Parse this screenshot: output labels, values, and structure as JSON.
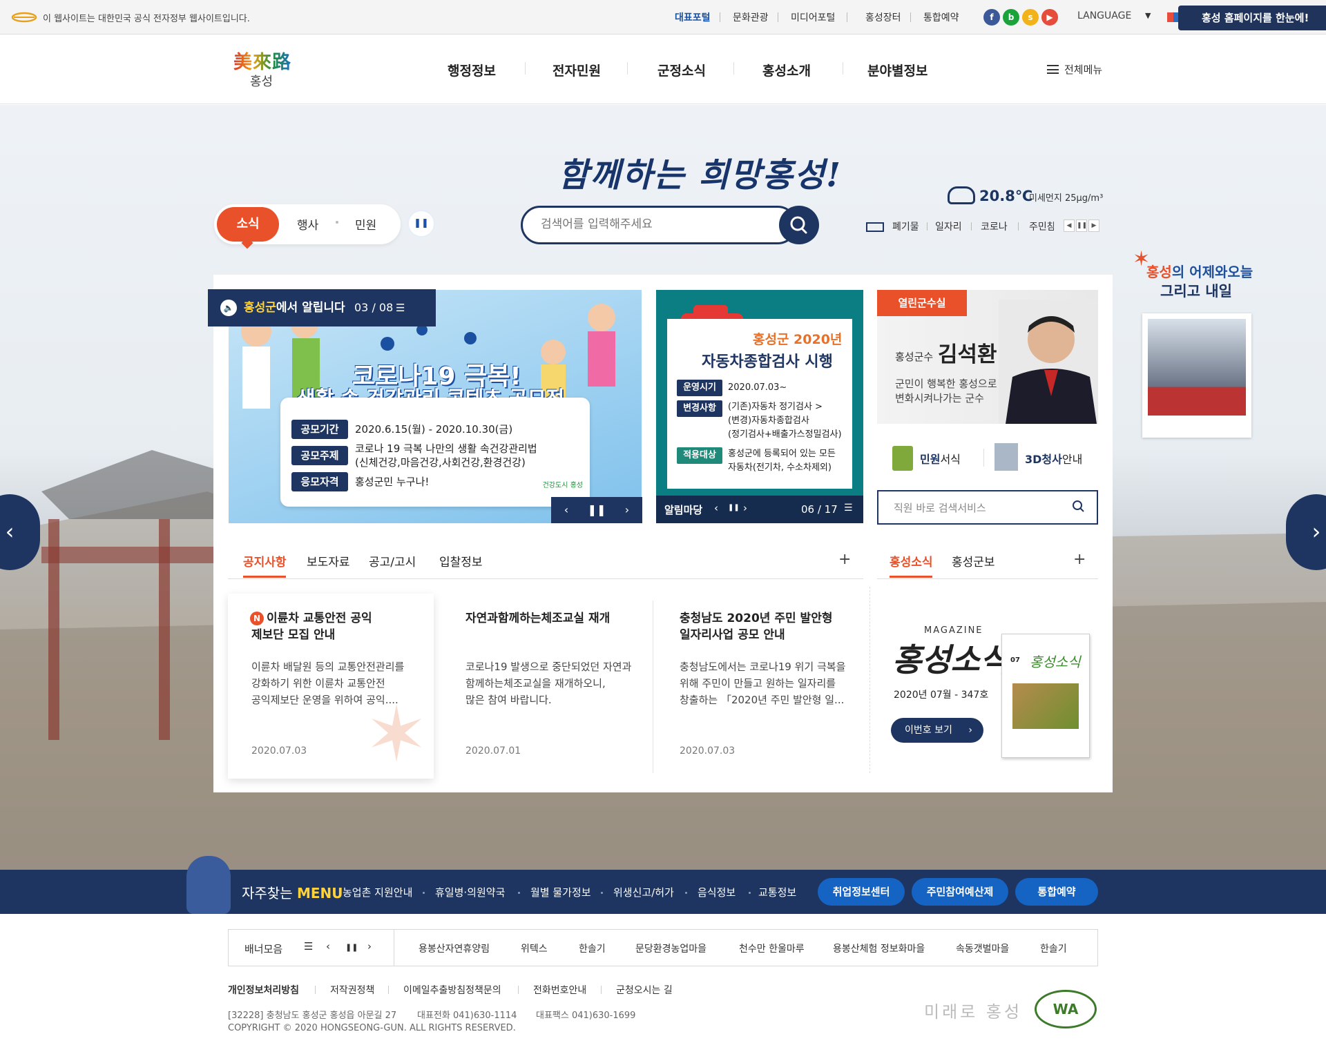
{
  "util": {
    "gov_notice": "이 웹사이트는 대한민국 공식 전자정부 웹사이트입니다.",
    "links": [
      "대표포털",
      "문화관광",
      "미디어포털",
      "홍성장터",
      "통합예약"
    ],
    "language": "LANGUAGE",
    "promo": "홍성 홈페이지를 한눈에!"
  },
  "header": {
    "logo_hanja": "美來路",
    "logo_sub": "홍성",
    "gnb": [
      "행정정보",
      "전자민원",
      "군정소식",
      "홍성소개",
      "분야별정보"
    ],
    "allmenu": "전체메뉴"
  },
  "visual": {
    "slogan": "함께하는 희망홍성!",
    "tabs": [
      "소식",
      "행사",
      "민원"
    ],
    "search_placeholder": "검색어를 입력해주세요",
    "weather": {
      "temp": "20.8℃",
      "dust": "미세먼지 25μg/m³"
    },
    "keywords": [
      "폐기물",
      "일자리",
      "코로나",
      "주민참"
    ]
  },
  "notice_banner": {
    "label_pre": "홍성군",
    "label_post": "에서 알립니다",
    "count": "03 / 08",
    "title1": "코로나19 극복!",
    "title2": "생활 속 건강관리 콘텐츠 공모전",
    "rows": [
      {
        "badge": "공모기간",
        "text": "2020.6.15(월) - 2020.10.30(금)"
      },
      {
        "badge": "공모주제",
        "text": "코로나 19 극복 나만의 생활 속건강관리법",
        "text2": "(신체건강,마음건강,사회건강,환경건강)"
      },
      {
        "badge": "응모자격",
        "text": "홍성군민 누구나!"
      }
    ],
    "brand": "건강도시 홍성"
  },
  "car_banner": {
    "title1": "홍성군 2020년",
    "title2": "자동차종합검사 시행",
    "rows": [
      {
        "badge": "운영시기",
        "text": "2020.07.03~"
      },
      {
        "badge": "변경사항",
        "text": "(기존)자동차 정기검사 >",
        "text2": "(변경)자동차종합검사",
        "text3": "(정기검사+배출가스정밀검사)"
      },
      {
        "badge": "적용대상",
        "text": "홍성군에 등록되어 있는 모든",
        "text2": "자동차(전기차, 수소차제외)"
      }
    ],
    "bar_label": "알림마당",
    "bar_count": "06 / 17"
  },
  "governor": {
    "tag": "열린군수실",
    "name_sub": "홍성군수",
    "name": "김석환",
    "desc1": "군민이 행복한 홍성으로",
    "desc2": "변화시켜나가는 군수"
  },
  "quick": {
    "civil_form_bold": "민원",
    "civil_form_rest": "서식",
    "hall_bold": "3D청사",
    "hall_rest": "안내",
    "staff_search": "직원 바로 검색서비스"
  },
  "board": {
    "tabs": [
      "공지사항",
      "보도자료",
      "공고/고시",
      "입찰정보"
    ],
    "plus": "+",
    "n_badge": "N",
    "items": [
      {
        "title1": "이륜차 교통안전 공익",
        "title2": "제보단 모집 안내",
        "body": [
          "이륜차 배달원 등의 교통안전관리를",
          "강화하기 위한 이륜차 교통안전",
          "공익제보단 운영을 위하여 공익...."
        ],
        "date": "2020.07.03"
      },
      {
        "title1": "자연과함께하는체조교실 재개",
        "title2": "",
        "body": [
          "코로나19 발생으로 중단되었던 자연과",
          "함께하는체조교실을 재개하오니,",
          "많은 참여 바랍니다."
        ],
        "date": "2020.07.01"
      },
      {
        "title1": "충청남도 2020년 주민 발안형",
        "title2": "일자리사업 공모 안내",
        "body": [
          "충청남도에서는 코로나19 위기 극복을",
          "위해 주민이 만들고 원하는 일자리를",
          "창출하는 「2020년 주민 발안형 일..."
        ],
        "date": "2020.07.03"
      }
    ]
  },
  "magazine": {
    "tabs": [
      "홍성소식",
      "홍성군보"
    ],
    "plus": "+",
    "label": "MAGAZINE",
    "title": "홍성소식",
    "issue": "2020년 07월 - 347호",
    "button": "이번호 보기",
    "cover_issue": "07"
  },
  "promo_side": {
    "line1_a": "홍성",
    "line1_b": "의 어제와오늘",
    "line2": "그리고 내일"
  },
  "freq": {
    "title_a": "자주찾는",
    "title_b": "MENU",
    "links": [
      "농업촌 지원안내",
      "휴일병·의원약국",
      "월별 물가정보",
      "위생신고/허가",
      "음식정보",
      "교통정보"
    ],
    "buttons": [
      "취업정보센터",
      "주민참여예산제",
      "통합예약"
    ]
  },
  "banners": {
    "label": "배너모음",
    "items": [
      "용봉산자연휴양림",
      "위텍스",
      "한솔기",
      "문당환경농업마을",
      "천수만 한울마루",
      "용봉산체험 정보화마을",
      "속동갯벌마을",
      "한솔기"
    ]
  },
  "footer": {
    "links": [
      "개인정보처리방침",
      "저작권정책",
      "이메일추출방침정책문의",
      "전화번호안내",
      "군청오시는 길"
    ],
    "address": "[32228] 충청남도 홍성군 홍성읍 아문길 27",
    "tel": "대표전화  041)630-1114",
    "fax": "대표팩스  041)630-1699",
    "copyright": "COPYRIGHT © 2020 HONGSEONG-GUN.  ALL RIGHTS RESERVED.",
    "logo": "미래로 홍성",
    "wa": "WA"
  },
  "colors": {
    "navy": "#1d3560",
    "orange": "#e8512a",
    "teal": "#0a7e83"
  }
}
